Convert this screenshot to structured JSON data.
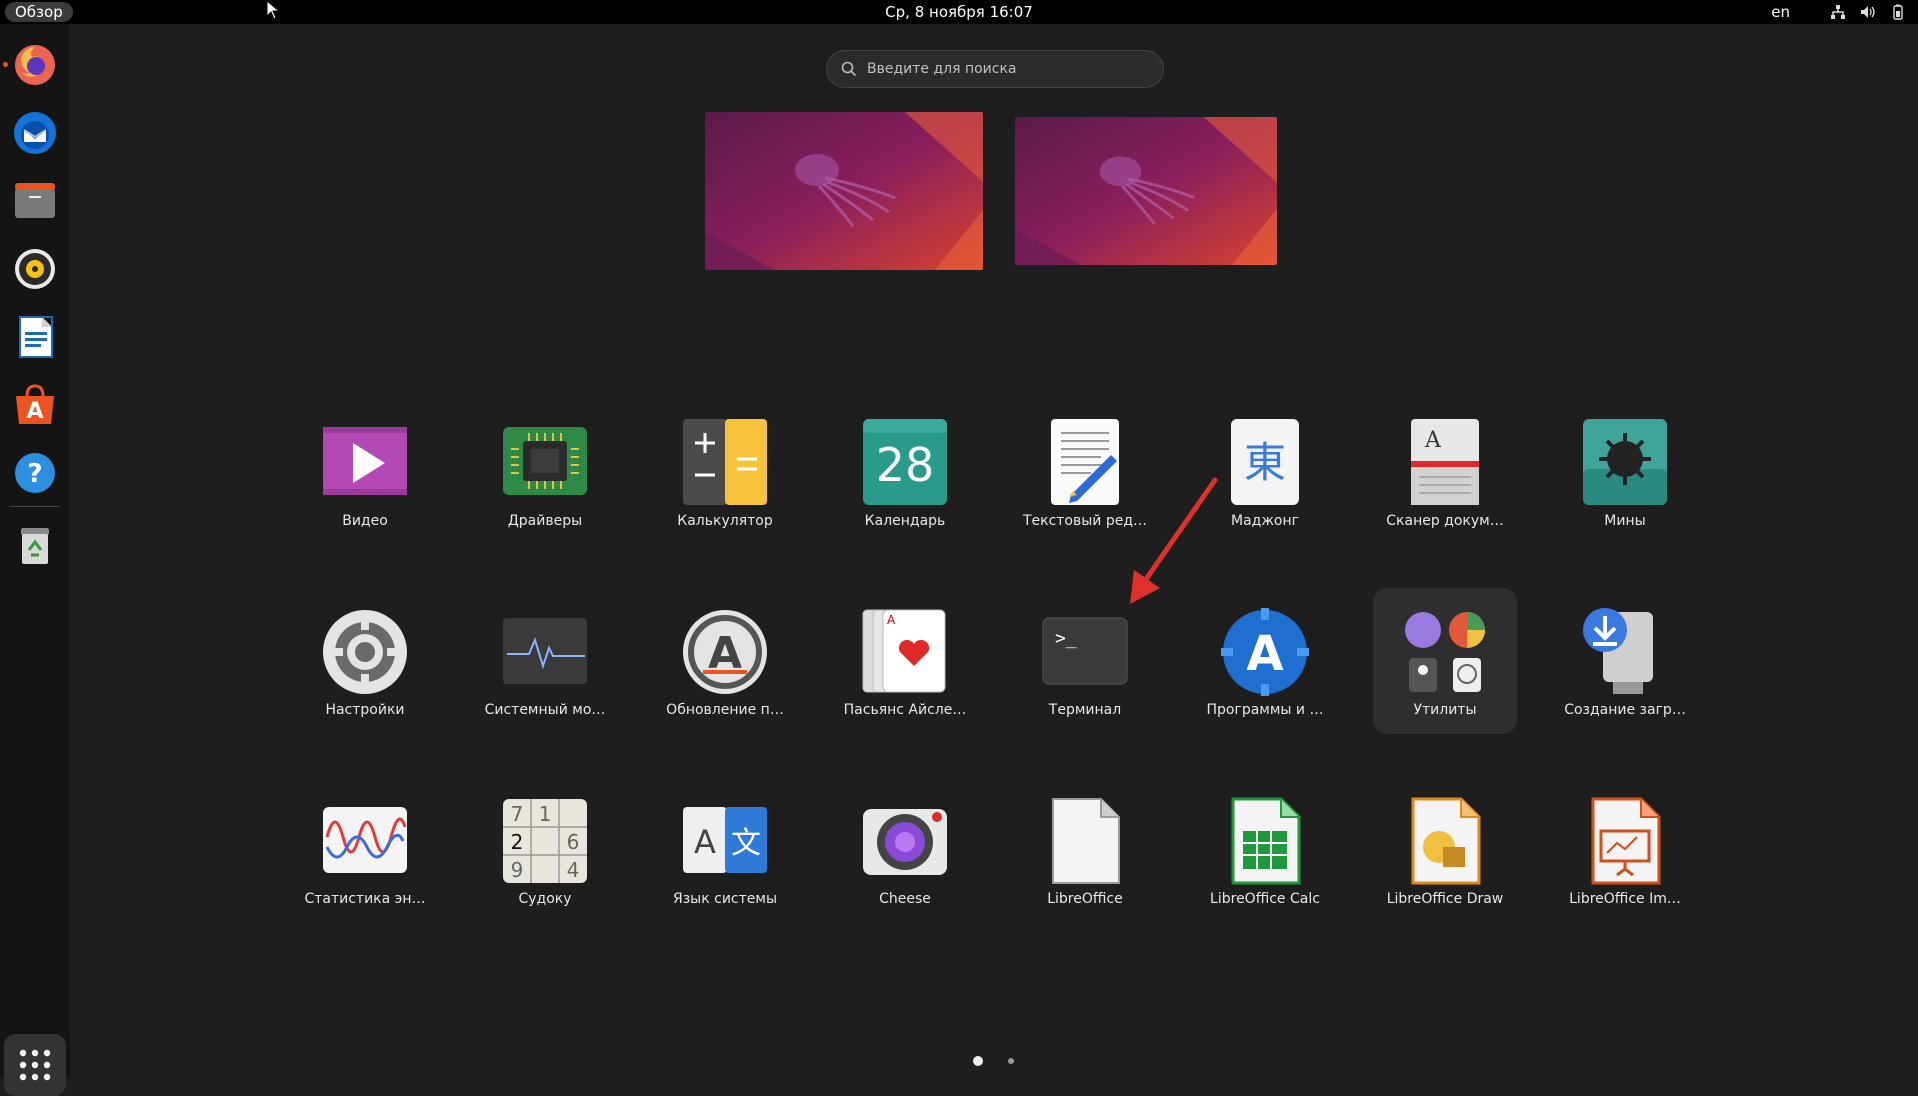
{
  "topbar": {
    "activities": "Обзор",
    "clock": "Ср, 8 ноября  16:07",
    "language": "en",
    "tray_icons": [
      "network-icon",
      "volume-icon",
      "battery-icon"
    ]
  },
  "dock": {
    "items": [
      {
        "name": "firefox-icon",
        "running": true
      },
      {
        "name": "thunderbird-icon",
        "running": false
      },
      {
        "name": "files-icon",
        "running": false
      },
      {
        "name": "rhythmbox-icon",
        "running": false
      },
      {
        "name": "libreoffice-writer-icon",
        "running": false
      },
      {
        "name": "app-center-icon",
        "running": false
      },
      {
        "name": "help-icon",
        "running": false
      },
      {
        "name": "trash-icon",
        "running": false
      }
    ],
    "show_apps_icon": "grid-icon"
  },
  "search": {
    "placeholder": "Введите для поиска"
  },
  "workspaces": [
    {
      "name": "workspace-1"
    },
    {
      "name": "workspace-2"
    }
  ],
  "apps": [
    {
      "label": "Видео",
      "icon": "video-icon"
    },
    {
      "label": "Драйверы",
      "icon": "drivers-icon"
    },
    {
      "label": "Калькулятор",
      "icon": "calculator-icon"
    },
    {
      "label": "Календарь",
      "icon": "calendar-icon",
      "day": "28"
    },
    {
      "label": "Текстовый ред…",
      "icon": "text-editor-icon"
    },
    {
      "label": "Маджонг",
      "icon": "mahjong-icon",
      "glyph": "東"
    },
    {
      "label": "Сканер докум…",
      "icon": "document-scanner-icon"
    },
    {
      "label": "Мины",
      "icon": "mines-icon"
    },
    {
      "label": "Настройки",
      "icon": "settings-icon"
    },
    {
      "label": "Системный мо…",
      "icon": "system-monitor-icon"
    },
    {
      "label": "Обновление п…",
      "icon": "software-updater-icon"
    },
    {
      "label": "Пасьянс Айсле…",
      "icon": "aisleriot-icon"
    },
    {
      "label": "Терминал",
      "icon": "terminal-icon",
      "prompt": ">_"
    },
    {
      "label": "Программы и …",
      "icon": "software-properties-icon"
    },
    {
      "label": "Утилиты",
      "icon": "utilities-folder-icon"
    },
    {
      "label": "Создание загр…",
      "icon": "usb-creator-icon"
    },
    {
      "label": "Статистика эн…",
      "icon": "power-statistics-icon"
    },
    {
      "label": "Судоку",
      "icon": "sudoku-icon"
    },
    {
      "label": "Язык системы",
      "icon": "language-support-icon"
    },
    {
      "label": "Cheese",
      "icon": "cheese-icon"
    },
    {
      "label": "LibreOffice",
      "icon": "libreoffice-icon"
    },
    {
      "label": "LibreOffice Calc",
      "icon": "libreoffice-calc-icon"
    },
    {
      "label": "LibreOffice Draw",
      "icon": "libreoffice-draw-icon"
    },
    {
      "label": "LibreOffice Im…",
      "icon": "libreoffice-impress-icon"
    }
  ],
  "colors": {
    "accent": "#e95420",
    "annotation_arrow": "#e0302a",
    "panel": "#000000",
    "background": "#1e1e1e"
  },
  "pagination": {
    "pages": 2,
    "current": 1
  },
  "annotation": {
    "type": "red-arrow",
    "points_to": "Терминал"
  }
}
